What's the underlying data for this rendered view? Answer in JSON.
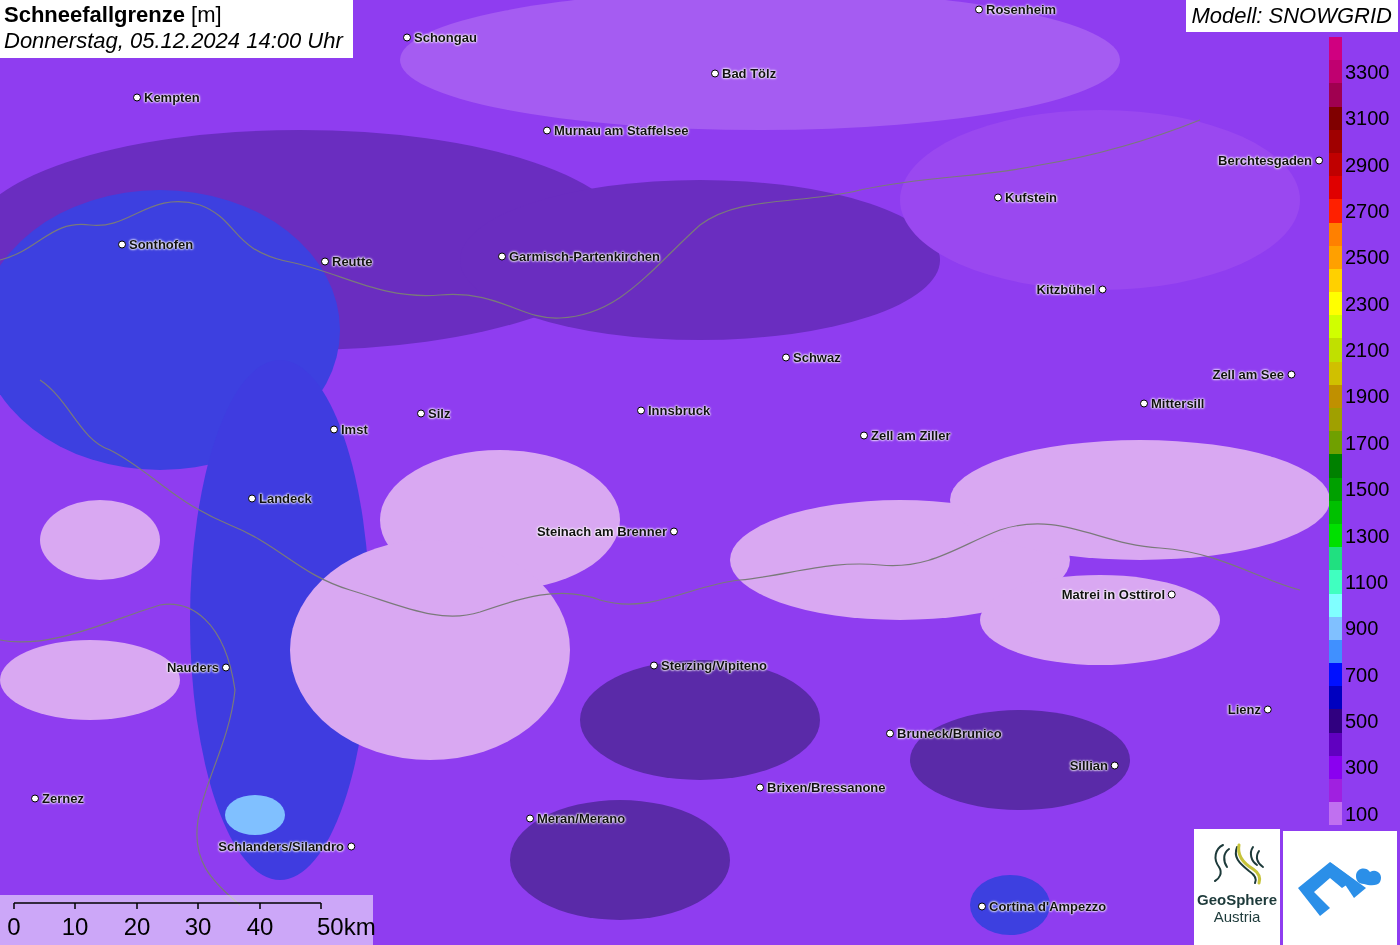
{
  "title": {
    "parameter": "Schneefallgrenze",
    "unit": "[m]",
    "datetime": "Donnerstag, 05.12.2024 14:00 Uhr"
  },
  "model": "Modell: SNOWGRID",
  "cities": [
    {
      "name": "Rosenheim"
    },
    {
      "name": "Schongau"
    },
    {
      "name": "Bad Tölz"
    },
    {
      "name": "Kempten"
    },
    {
      "name": "Murnau am Staffelsee"
    },
    {
      "name": "Berchtesgaden"
    },
    {
      "name": "Kufstein"
    },
    {
      "name": "Sonthofen"
    },
    {
      "name": "Reutte"
    },
    {
      "name": "Garmisch-Partenkirchen"
    },
    {
      "name": "Kitzbühel"
    },
    {
      "name": "Schwaz"
    },
    {
      "name": "Zell am See"
    },
    {
      "name": "Mittersill"
    },
    {
      "name": "Innsbruck"
    },
    {
      "name": "Silz"
    },
    {
      "name": "Imst"
    },
    {
      "name": "Zell am Ziller"
    },
    {
      "name": "Landeck"
    },
    {
      "name": "Steinach am Brenner"
    },
    {
      "name": "Matrei in Osttirol"
    },
    {
      "name": "Nauders"
    },
    {
      "name": "Sterzing/Vipiteno"
    },
    {
      "name": "Lienz"
    },
    {
      "name": "Bruneck/Brunico"
    },
    {
      "name": "Sillian"
    },
    {
      "name": "Brixen/Bressanone"
    },
    {
      "name": "Zernez"
    },
    {
      "name": "Meran/Merano"
    },
    {
      "name": "Schlanders/Silandro"
    },
    {
      "name": "Cortina d'Ampezzo"
    }
  ],
  "legend": [
    {
      "color": "#d00080"
    },
    {
      "label": "3300",
      "color": "#c00070"
    },
    {
      "color": "#a00050"
    },
    {
      "label": "3100",
      "color": "#800000"
    },
    {
      "color": "#a00000"
    },
    {
      "label": "2900",
      "color": "#c00000"
    },
    {
      "color": "#e00000"
    },
    {
      "label": "2700",
      "color": "#ff2000"
    },
    {
      "color": "#ff8000"
    },
    {
      "label": "2500",
      "color": "#ffa000"
    },
    {
      "color": "#ffd000"
    },
    {
      "label": "2300",
      "color": "#ffff00"
    },
    {
      "color": "#d0ff00"
    },
    {
      "label": "2100",
      "color": "#c0e000"
    },
    {
      "color": "#d0c000"
    },
    {
      "label": "1900",
      "color": "#c09000"
    },
    {
      "color": "#a0a000"
    },
    {
      "label": "1700",
      "color": "#70a000"
    },
    {
      "color": "#008000"
    },
    {
      "label": "1500",
      "color": "#00a000"
    },
    {
      "color": "#00c000"
    },
    {
      "label": "1300",
      "color": "#00e000"
    },
    {
      "color": "#20e080"
    },
    {
      "label": "1100",
      "color": "#40ffc0"
    },
    {
      "color": "#80ffff"
    },
    {
      "label": "900",
      "color": "#80c0ff"
    },
    {
      "color": "#4090ff"
    },
    {
      "label": "700",
      "color": "#0010ff"
    },
    {
      "color": "#0000c0"
    },
    {
      "label": "500",
      "color": "#300080"
    },
    {
      "color": "#6000c0"
    },
    {
      "label": "300",
      "color": "#8a00f0"
    },
    {
      "color": "#a020e0"
    },
    {
      "label": "100",
      "color": "#c070f0"
    }
  ],
  "scale": [
    "0",
    "10",
    "20",
    "30",
    "40",
    "50km"
  ],
  "logos": {
    "geosphere": [
      "GeoSphere",
      "Austria"
    ]
  }
}
